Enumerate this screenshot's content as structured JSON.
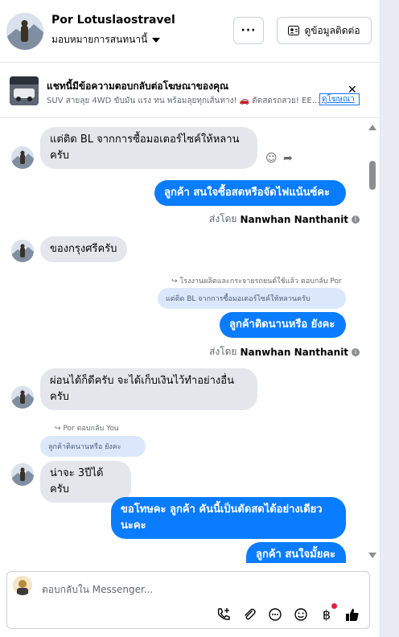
{
  "header": {
    "name": "Por Lotuslaostravel",
    "assign_label": "มอบหมายการสนทนานี้",
    "more_label": "···",
    "contact_button": "ดูข้อมูลติดต่อ"
  },
  "ad_banner": {
    "title": "แชทนี้มีข้อความตอบกลับต่อโฆษณาของคุณ",
    "subtitle": "SUV สายลุย 4WD ขับมัน แรง ทน พร้อมลุยทุกเส้นทาง! 🚗 ดัดสดรถสวย! EE...",
    "link": "ดูโฆษณา",
    "close": "✕"
  },
  "messages": {
    "m1": "แต่ติด BL จากการซื้อมอเตอร์ไซค์ให้หลาน\nครับ",
    "m2": "ลูกค้า สนใจซื้อสดหรือจัดไฟแน้นซ์คะ",
    "m2_sentby_prefix": "ส่งโดย",
    "m2_sentby_name": "Nanwhan Nanthanit",
    "m3": "ของกรุงศรีครับ",
    "m4_reply_label": "โรงงานผลิตและกระจายรถยนต์ใช้แล้ว ตอบกลับ Por",
    "m4_quote": "แต่ติด BL จากการซื้อมอเตอร์ไซค์ให้หลานครับ",
    "m4": "ลูกค้าติดนานหรือ ยังคะ",
    "m4_sentby_prefix": "ส่งโดย",
    "m4_sentby_name": "Nanwhan Nanthanit",
    "m5": "ผ่อนได้ก็ดีครับ จะได้เก็บเงินไว้ทำอย่างอื่น\nครับ",
    "m6_reply_label": "Por ตอบกลับ You",
    "m6_quote": "ลูกค้าติดนานหรือ ยังคะ",
    "m6": "น่าจะ 3ปีได้ครับ",
    "m7": "ขอโทษคะ ลูกค้า คันนี้เป็นดัดสดได้อย่างเดียว\nนะคะ",
    "m8": "ลูกค้า สนใจมั้ยคะ"
  },
  "composer": {
    "placeholder": "ตอบกลับใน Messenger..."
  },
  "icons": {
    "info": "i",
    "reply_arrow": "↪",
    "emoji": "☺",
    "forward": "➦"
  },
  "colors": {
    "outgoing": "#0a7cff",
    "incoming": "#e4e6eb",
    "quoted": "#dbe8fb"
  }
}
